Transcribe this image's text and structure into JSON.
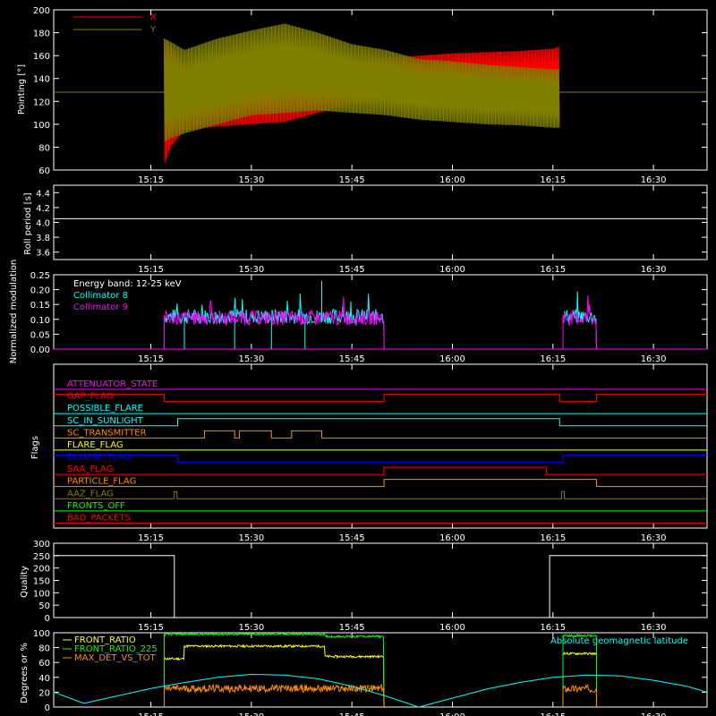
{
  "colors": {
    "background": "#000000",
    "axis": "#ffffff",
    "x_series": "#ff0000",
    "y_series": "#808000",
    "collimator8": "#00ffff",
    "collimator9": "#ff00ff",
    "front_ratio": "#ffff00",
    "front_ratio_225": "#00ff00",
    "max_det": "#ff8c00",
    "geo_lat": "#00ffff"
  },
  "time_axis": {
    "tick_labels": [
      "15:15",
      "15:30",
      "15:45",
      "16:00",
      "16:15",
      "16:30"
    ],
    "tick_minutes": [
      15,
      30,
      45,
      60,
      75,
      90
    ],
    "range_minutes": [
      0.5,
      98
    ]
  },
  "chart_data": [
    {
      "type": "line",
      "panel": "pointing",
      "ylabel": "Pointing [°]",
      "ylim": [
        60,
        200
      ],
      "yticks": [
        "60",
        "80",
        "100",
        "120",
        "140",
        "160",
        "180",
        "200"
      ],
      "legend": [
        "X",
        "Y"
      ],
      "baseline": 128,
      "series": [
        {
          "name": "X",
          "x_minutes": [
            17,
            18,
            20,
            25,
            30,
            35,
            40,
            45,
            50,
            55,
            60,
            65,
            70,
            75,
            76
          ],
          "upper": [
            175,
            168,
            150,
            158,
            165,
            168,
            162,
            156,
            158,
            160,
            162,
            163,
            164,
            166,
            168
          ],
          "lower": [
            65,
            80,
            95,
            98,
            100,
            102,
            110,
            118,
            120,
            118,
            116,
            114,
            112,
            110,
            102
          ]
        },
        {
          "name": "Y",
          "x_minutes": [
            17,
            18,
            20,
            25,
            30,
            35,
            40,
            45,
            50,
            55,
            60,
            65,
            70,
            75,
            76
          ],
          "upper": [
            175,
            172,
            165,
            175,
            182,
            188,
            180,
            170,
            165,
            157,
            155,
            152,
            150,
            148,
            148
          ],
          "lower": [
            85,
            88,
            92,
            100,
            108,
            110,
            112,
            110,
            108,
            104,
            102,
            100,
            99,
            97,
            97
          ]
        }
      ]
    },
    {
      "type": "line",
      "panel": "roll",
      "ylabel": "Roll period [s]",
      "ylim": [
        3.5,
        4.5
      ],
      "yticks": [
        "3.6",
        "3.8",
        "4.0",
        "4.2",
        "4.4"
      ],
      "value": 4.05
    },
    {
      "type": "line",
      "panel": "modulation",
      "ylabel": "Normalized modulation",
      "ylim": [
        0,
        0.25
      ],
      "yticks": [
        "0.00",
        "0.05",
        "0.10",
        "0.15",
        "0.20",
        "0.25"
      ],
      "annotation": "Energy band: 12-25 keV",
      "series": [
        {
          "name": "Collimator 8",
          "active": [
            [
              17,
              49.8
            ],
            [
              76.5,
              81.5
            ]
          ],
          "level": 0.11,
          "drops_to_zero": [
            20,
            27.5,
            33,
            38
          ]
        },
        {
          "name": "Collimator 9",
          "active": [
            [
              17,
              49.8
            ],
            [
              76.5,
              81.5
            ]
          ],
          "level": 0.105
        }
      ]
    },
    {
      "type": "line",
      "panel": "flags",
      "ylabel": "Flags",
      "flags": [
        {
          "name": "ATTENUATOR_STATE",
          "color": "#ff00ff",
          "segments": [
            [
              0.5,
              98,
              0
            ]
          ]
        },
        {
          "name": "GAP_FLAG",
          "color": "#ff0000",
          "segments": [
            [
              0.5,
              17,
              1
            ],
            [
              17,
              49.8,
              0
            ],
            [
              49.8,
              76,
              1
            ],
            [
              76,
              81.5,
              0
            ],
            [
              81.5,
              98,
              1
            ]
          ]
        },
        {
          "name": "POSSIBLE_FLARE",
          "color": "#00ffff",
          "segments": [
            [
              0.5,
              98,
              0
            ]
          ]
        },
        {
          "name": "SC_IN_SUNLIGHT",
          "color": "#00ffff",
          "segments": [
            [
              0.5,
              19,
              0
            ],
            [
              19,
              76,
              1
            ],
            [
              76,
              98,
              0
            ]
          ]
        },
        {
          "name": "SC_TRANSMITTER",
          "color": "#ff8c00",
          "segments": [
            [
              0.5,
              23,
              0
            ],
            [
              23,
              27.5,
              1
            ],
            [
              27.5,
              28.2,
              0
            ],
            [
              28.2,
              33,
              1
            ],
            [
              33,
              36,
              0
            ],
            [
              36,
              40.5,
              1
            ],
            [
              40.5,
              98,
              0
            ]
          ]
        },
        {
          "name": "FLARE_FLAG",
          "color": "#ffff00",
          "segments": [
            [
              0.5,
              98,
              0
            ]
          ]
        },
        {
          "name": "ECLIPSE_FLAG",
          "color": "#0000ff",
          "segments": [
            [
              0.5,
              19,
              1
            ],
            [
              19,
              76.5,
              0
            ],
            [
              76.5,
              98,
              1
            ]
          ]
        },
        {
          "name": "SAA_FLAG",
          "color": "#ff0000",
          "segments": [
            [
              0.5,
              49.8,
              0
            ],
            [
              49.8,
              74,
              1
            ],
            [
              74,
              98,
              0
            ]
          ]
        },
        {
          "name": "PARTICLE_FLAG",
          "color": "#ff8c00",
          "segments": [
            [
              0.5,
              49.8,
              0
            ],
            [
              49.8,
              81.5,
              1
            ],
            [
              81.5,
              98,
              0
            ]
          ]
        },
        {
          "name": "AAZ_FLAG",
          "color": "#808000",
          "segments": [
            [
              0.5,
              18.5,
              0
            ],
            [
              18.5,
              18.9,
              1
            ],
            [
              18.9,
              76.3,
              0
            ],
            [
              76.3,
              76.7,
              1
            ],
            [
              76.7,
              98,
              0
            ]
          ]
        },
        {
          "name": "FRONTS_OFF",
          "color": "#00ff00",
          "segments": [
            [
              0.5,
              98,
              0
            ]
          ]
        },
        {
          "name": "BAD_PACKETS",
          "color": "#ff0000",
          "segments": [
            [
              0.5,
              98,
              0
            ]
          ]
        }
      ]
    },
    {
      "type": "line",
      "panel": "quality",
      "ylabel": "Quality",
      "ylim": [
        0,
        300
      ],
      "yticks": [
        "0",
        "50",
        "100",
        "150",
        "200",
        "250",
        "300"
      ],
      "segments": [
        [
          0.5,
          18.5,
          250
        ],
        [
          18.5,
          74.5,
          0
        ],
        [
          74.5,
          98,
          250
        ]
      ]
    },
    {
      "type": "line",
      "panel": "ratios",
      "ylabel": "Degrees or %",
      "ylim": [
        0,
        100
      ],
      "yticks": [
        "0",
        "20",
        "40",
        "60",
        "80",
        "100"
      ],
      "legend": [
        "FRONT_RATIO",
        "FRONT_RATIO_225",
        "MAX_DET_VS_TOT"
      ],
      "annotation": "Absolute geomagnetic latitude",
      "series": [
        {
          "name": "FRONT_RATIO",
          "active": [
            [
              17,
              49.8
            ],
            [
              76.5,
              81.5
            ]
          ],
          "levels": [
            [
              17,
              20,
              65
            ],
            [
              20,
              41,
              82
            ],
            [
              41,
              49.8,
              68
            ],
            [
              76.5,
              81.5,
              72
            ]
          ]
        },
        {
          "name": "FRONT_RATIO_225",
          "active": [
            [
              17,
              49.8
            ],
            [
              76.5,
              81.5
            ]
          ],
          "levels": [
            [
              17,
              41,
              98
            ],
            [
              41,
              49.8,
              95
            ],
            [
              76.5,
              81.5,
              96
            ]
          ]
        },
        {
          "name": "MAX_DET_VS_TOT",
          "active": [
            [
              17,
              49.8
            ],
            [
              76.5,
              81.5
            ]
          ],
          "levels": [
            [
              17,
              49.8,
              25
            ],
            [
              76.5,
              81.5,
              25
            ]
          ]
        },
        {
          "name": "Absolute geomagnetic latitude",
          "x_minutes": [
            0.5,
            5,
            10,
            15,
            20,
            25,
            30,
            35,
            40,
            45,
            50,
            55,
            60,
            65,
            70,
            75,
            80,
            85,
            90,
            95,
            98
          ],
          "values": [
            20,
            5,
            15,
            25,
            33,
            40,
            44,
            43,
            38,
            28,
            15,
            0,
            12,
            24,
            33,
            40,
            43,
            42,
            36,
            28,
            20
          ]
        }
      ]
    }
  ]
}
